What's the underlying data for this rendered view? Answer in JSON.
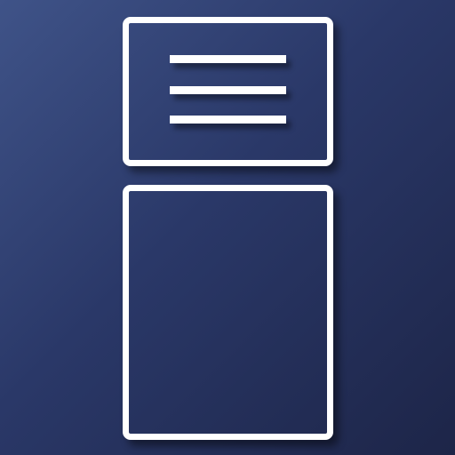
{
  "icon": {
    "name": "hamburger-menu-panel-layout-icon",
    "colors": {
      "background_light": "#3f5388",
      "background_dark": "#1d2548",
      "stroke": "#ffffff"
    },
    "top_panel": {
      "content": "hamburger-menu-icon",
      "line_count": 3
    },
    "bottom_panel": {
      "content": "empty"
    }
  }
}
